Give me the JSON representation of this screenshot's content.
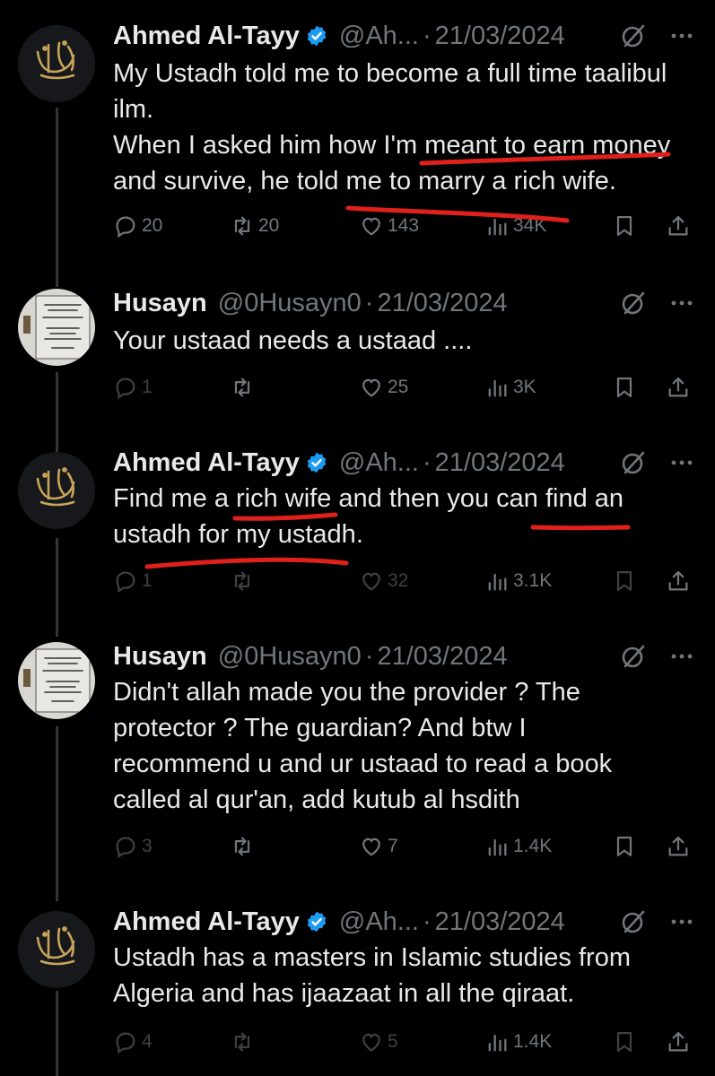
{
  "tweets": [
    {
      "name": "Ahmed Al-Tayy",
      "verified": true,
      "handle": "@Ah...",
      "date": "21/03/2024",
      "text_lines": [
        "My Ustadh told me to become a full time taalibul ilm.",
        "When I asked him how I'm meant to earn money and survive, he told me to marry a rich wife."
      ],
      "stats": {
        "replies": "20",
        "reposts": "20",
        "likes": "143",
        "views": "34K"
      }
    },
    {
      "name": "Husayn",
      "verified": false,
      "handle": "@0Husayn0",
      "date": "21/03/2024",
      "text_lines": [
        "Your ustaad needs a ustaad ...."
      ],
      "stats": {
        "replies": "1",
        "reposts": "",
        "likes": "25",
        "views": "3K"
      }
    },
    {
      "name": "Ahmed Al-Tayy",
      "verified": true,
      "handle": "@Ah...",
      "date": "21/03/2024",
      "text_lines": [
        "Find me a rich wife and then you can find an ustadh for my ustadh."
      ],
      "stats": {
        "replies": "1",
        "reposts": "",
        "likes": "32",
        "views": "3.1K"
      }
    },
    {
      "name": "Husayn",
      "verified": false,
      "handle": "@0Husayn0",
      "date": "21/03/2024",
      "text_lines": [
        "Didn't allah made you the provider ? The protector ? The guardian? And btw I recommend u and ur ustaad to read a book called al qur'an, add kutub al hsdith"
      ],
      "stats": {
        "replies": "3",
        "reposts": "",
        "likes": "7",
        "views": "1.4K"
      }
    },
    {
      "name": "Ahmed Al-Tayy",
      "verified": true,
      "handle": "@Ah...",
      "date": "21/03/2024",
      "text_lines": [
        "Ustadh has a masters in Islamic studies from Algeria and has ijaazaat in all the qiraat."
      ],
      "stats": {
        "replies": "4",
        "reposts": "",
        "likes": "5",
        "views": "1.4K"
      }
    }
  ],
  "colors": {
    "background": "#000000",
    "text": "#e7e9ea",
    "muted": "#71767b",
    "verified": "#1d9bf0",
    "annotation": "#e0201a",
    "thread_line": "#333639"
  },
  "icons": [
    "reply-icon",
    "repost-icon",
    "like-icon",
    "views-icon",
    "bookmark-icon",
    "share-icon",
    "grok-icon",
    "more-icon",
    "verified-badge-icon"
  ]
}
